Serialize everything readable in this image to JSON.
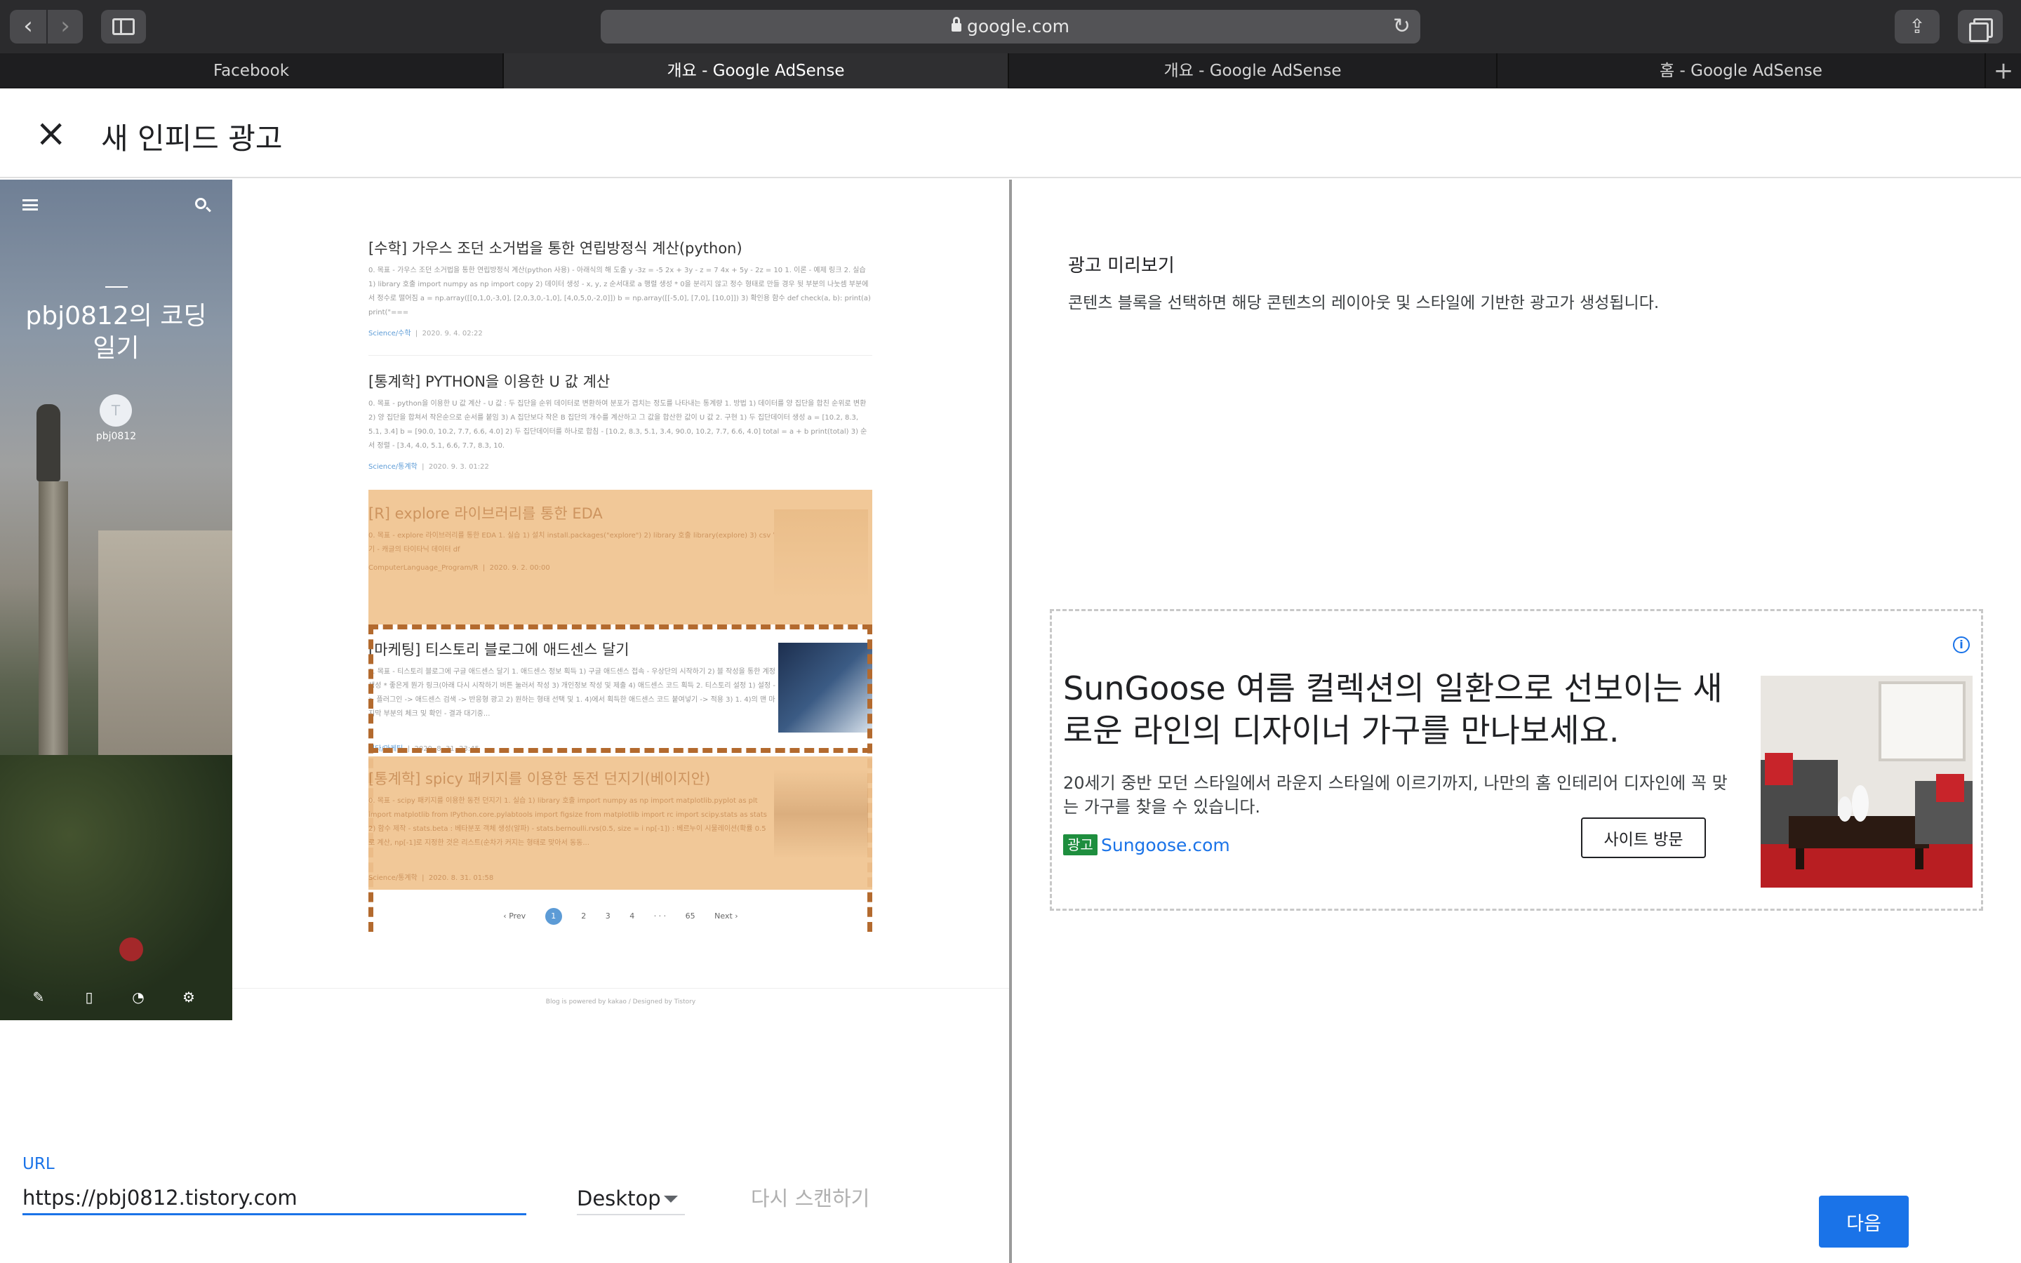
{
  "browser": {
    "address": "google.com",
    "tabs": [
      {
        "label": "Facebook"
      },
      {
        "label": "개요 - Google AdSense"
      },
      {
        "label": "개요 - Google AdSense"
      },
      {
        "label": "홈 - Google AdSense"
      }
    ]
  },
  "dialog": {
    "title": "새 인피드 광고"
  },
  "blog": {
    "name": "pbj0812의 코딩 일기",
    "user": "pbj0812",
    "avatar_letter": "T",
    "posts": [
      {
        "title": "[수학] 가우스 조던 소거법을 통한 연립방정식 계산(python)",
        "body": "0. 목표 - 가우스 조던 소거법을 통한 연립방정식 계산(python 사용) - 아래식의 해 도출 y -3z = -5 2x + 3y - z = 7 4x + 5y - 2z = 10 1. 이론 - 예제 링크 2. 실습 1) library 호출 import numpy as np import copy 2) 데이터 생성 - x, y, z 순서대로 a 행렬 생성 * 0을 분리지 않고 정수 형태로 만들 경우 뒷 부분의 나눗셈 부분에서 정수로 떨어짐 a = np.array([[0,1,0,-3,0], [2,0,3,0,-1,0], [4,0,5,0,-2,0]]) b = np.array([[-5,0], [7,0], [10,0]]) 3) 확인용 함수 def check(a, b): print(a) print(\"===",
        "category": "Science/수학",
        "date": "2020. 9. 4. 02:22"
      },
      {
        "title": "[통계학] PYTHON을 이용한 U 값 계산",
        "body": "0. 목표 - python을 이용한 U 값 계산 - U 값 : 두 집단을 순위 데이터로 변환하여 분포가 겹치는 정도를 나타내는 통계량 1. 방법 1) 데이터를 양 집단을 합친 순위로 변환 2) 양 집단을 합쳐서 작은순으로 순서를 붙임 3) A 집단보다 작은 B 집단의 개수를 계산하고 그 값을 합산한 값이 U 값 2. 구현 1) 두 집단데이터 생성 a = [10.2, 8.3, 5.1, 3.4] b = [90.0, 10.2, 7.7, 6.6, 4.0] 2) 두 집단데이터를 하나로 합침 - [10.2, 8.3, 5.1, 3.4, 90.0, 10.2, 7.7, 6.6, 4.0] total = a + b print(total) 3) 순서 정렬 - [3.4, 4.0, 5.1, 6.6, 7.7, 8.3, 10.",
        "category": "Science/통계학",
        "date": "2020. 9. 3. 01:22"
      },
      {
        "title": "[R] explore 라이브러리를 통한 EDA",
        "body": "0. 목표 - explore 라이브러리를 통한 EDA 1. 실습 1) 설치 install.packages(\"explore\") 2) library 호출 library(explore) 3) csv 읽기 - 캐글의 타이타닉 데이터 df",
        "category": "ComputerLanguage_Program/R",
        "date": "2020. 9. 2. 00:00"
      },
      {
        "title": "[마케팅] 티스토리 블로그에 애드센스 달기",
        "body": "0. 목표 - 티스토리 블로그에 구글 애드센스 달기 1. 애드센스 정보 획득 1) 구글 애드센스 접속 - 우상단의 시작하기 2) 블 작성을 통한 계정 생성 * 좋은게 뭔가 링크(아래 다시 시작하기 버튼 눌러서 작성 3) 개인정보 작성 및 제출 4) 애드센스 코드 획득 2. 티스토리 설정 1) 설정 -> 플러그인 -> 애드센스 검색 -> 반응형 광고 2) 원하는 형태 선택 및 1. 4)에서 획득한 애드센스 코드 붙여넣기 -> 적용 3) 1. 4)의 맨 마지막 부분의 체크 및 확인 - 결과 대기중...",
        "category": "기타/마케팅",
        "date": "2020. 8. 31. 23:45"
      },
      {
        "title": "[통계학] spicy 패키지를 이용한 동전 던지기(베이지안)",
        "body": "0. 목표 - scipy 패키지를 이용한 동전 던지기 1. 실습 1) library 호출 import numpy as np import matplotlib.pyplot as plt import matplotlib from IPython.core.pylabtools import figsize from matplotlib import rc import scipy.stats as stats 2) 함수 제작 - stats.beta : 베타분포 객체 생성(알파) - stats.bernoulli.rvs(0.5, size = i np[-1]) : 베르누이 시물레이션(확률 0.5로 계산, np[-1]로 지정한 것은 리스트(순차가 커지는 형태로 맞아서 동동...",
        "category": "Science/통계학",
        "date": "2020. 8. 31. 01:58"
      }
    ],
    "pager": {
      "prev": "Prev",
      "pages": [
        "1",
        "2",
        "3",
        "4"
      ],
      "ellipsis": "· · ·",
      "last": "65",
      "next": "Next"
    },
    "footer": "Blog is powered by kakao / Designed by Tistory"
  },
  "form": {
    "url_label": "URL",
    "url_value": "https://pbj0812.tistory.com",
    "device": "Desktop",
    "rescan": "다시 스캔하기"
  },
  "preview": {
    "title": "광고 미리보기",
    "description": "콘텐츠 블록을 선택하면 해당 콘텐츠의 레이아웃 및 스타일에 기반한 광고가 생성됩니다.",
    "ad": {
      "headline": "SunGoose 여름 컬렉션의 일환으로 선보이는 새로운 라인의 디자이너 가구를 만나보세요.",
      "description": "20세기 중반 모던 스타일에서 라운지 스타일에 이르기까지, 나만의 홈 인테리어 디자인에 꼭 맞는 가구를 찾을 수 있습니다.",
      "badge": "광고",
      "domain": "Sungoose.com",
      "cta": "사이트 방문",
      "info": "i"
    },
    "next": "다음"
  },
  "colors": {
    "accent": "#1a73e8",
    "highlight": "#f0c490",
    "highlight_border": "#b36a2e",
    "ad_badge": "#1e8e3e"
  },
  "icons": [
    "back-icon",
    "forward-icon",
    "sidebar-icon",
    "lock-icon",
    "reload-icon",
    "share-icon",
    "tabs-icon",
    "plus-icon",
    "close-icon",
    "menu-icon",
    "search-icon",
    "write-icon",
    "book-icon",
    "rss-icon",
    "gear-icon",
    "info-icon",
    "caret-down-icon"
  ]
}
